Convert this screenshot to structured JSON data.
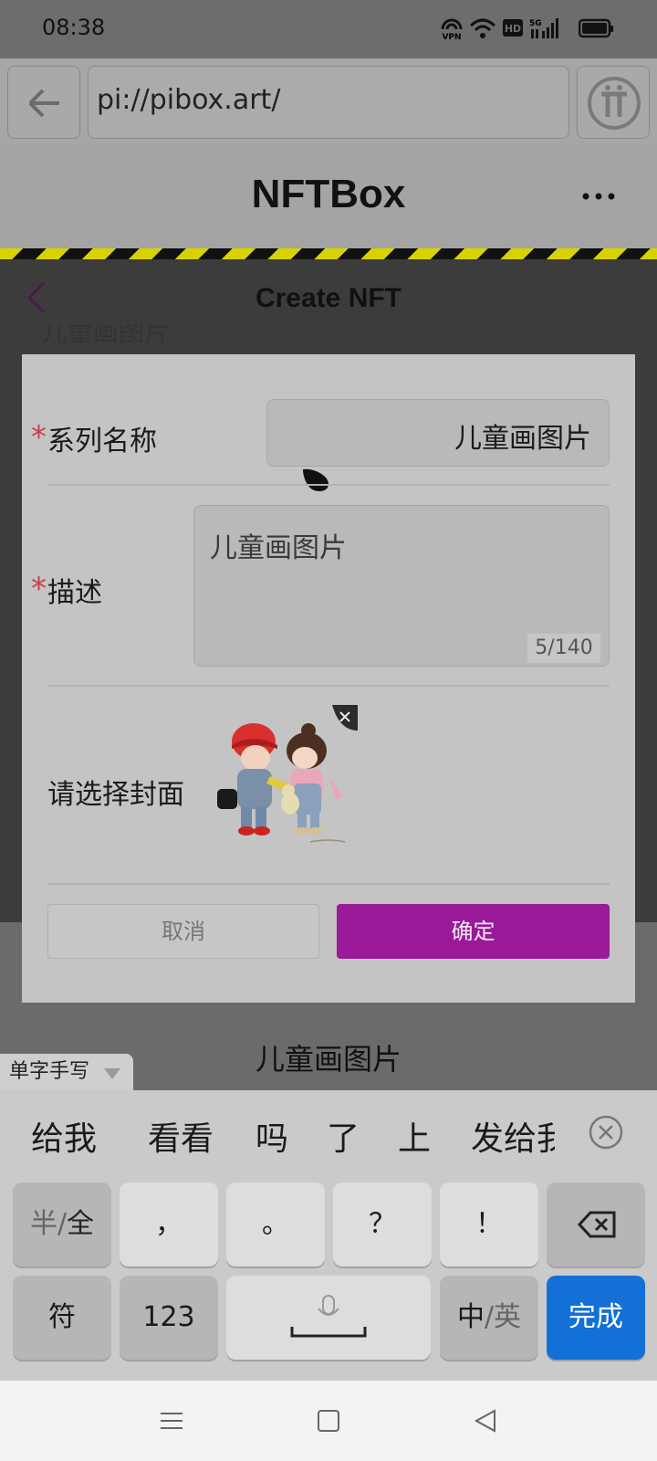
{
  "status_bar": {
    "time": "08:38",
    "icons": [
      "vpn-icon",
      "wifi-icon",
      "hd-icon",
      "5g-signal-icon",
      "battery-icon"
    ],
    "vpn_label": "VPN",
    "hd_label": "HD",
    "network_label": "5G"
  },
  "browser": {
    "url": "pi://pibox.art/",
    "icons": [
      "back-arrow-icon",
      "pi-logo-icon"
    ]
  },
  "app": {
    "title": "NFTBox",
    "more_icon": "more-dots-icon"
  },
  "page": {
    "title": "Create NFT",
    "series_peek": "儿童画图片",
    "caption_below": "儿童画图片"
  },
  "dialog": {
    "series_label": "系列名称",
    "series_value": "儿童画图片",
    "description_label": "描述",
    "description_value": "儿童画图片",
    "description_counter": "5/140",
    "cover_label": "请选择封面",
    "cancel_label": "取消",
    "confirm_label": "确定",
    "required_mark": "*"
  },
  "ime": {
    "handwrite_mode": "单字手写",
    "candidates": [
      "给我",
      "看看",
      "吗",
      "了",
      "上",
      "发给我"
    ],
    "keys": {
      "halfwidth_a": "半",
      "halfwidth_sep": "/",
      "halfwidth_b": "全",
      "comma": "，",
      "period": "。",
      "question": "？",
      "exclaim": "！",
      "symbols": "符",
      "numbers": "123",
      "lang_a": "中",
      "lang_sep": "/",
      "lang_b": "英",
      "done": "完成"
    }
  },
  "colors": {
    "confirm": "#9a1a9a",
    "done_key": "#1270d6",
    "required": "#c6414a",
    "hazard_yellow": "#d8d300"
  }
}
